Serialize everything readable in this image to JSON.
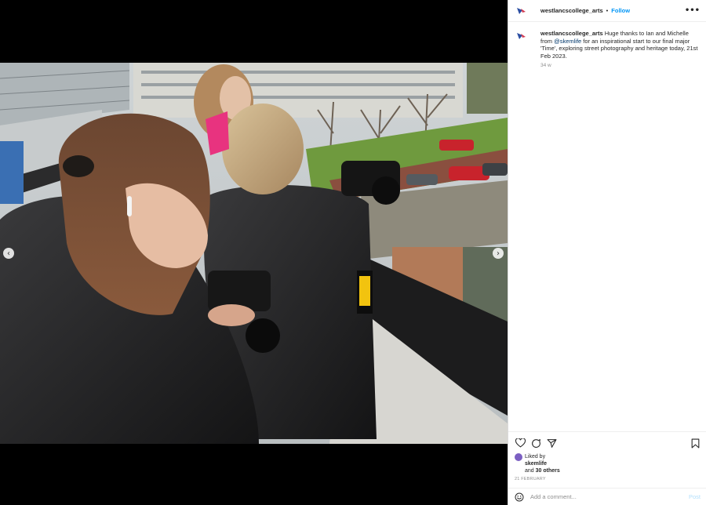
{
  "post": {
    "username": "westlancscollege_arts",
    "separator": "•",
    "follow_label": "Follow",
    "more_icon": "more-horizontal-icon",
    "caption": {
      "username": "westlancscollege_arts",
      "text_part1": " Huge thanks to Ian and Michelle from ",
      "mention": "@skemlife",
      "text_part2": " for an inspirational start to our final major 'Time', exploring street photography and heritage today, 21st Feb 2023."
    },
    "time_ago": "34 w",
    "likes": {
      "prefix": "Liked by",
      "first_liker": "skemlife",
      "and_text": "and",
      "others": "30 others"
    },
    "date": "21 FEBRUARY",
    "comment_placeholder": "Add a comment...",
    "post_label": "Post"
  },
  "media": {
    "prev_icon": "chevron-left-icon",
    "next_icon": "chevron-right-icon"
  },
  "colors": {
    "accent": "#0095f6",
    "mention": "#00376b",
    "muted": "#8e8e8e",
    "post_disabled": "#b2dffc"
  }
}
